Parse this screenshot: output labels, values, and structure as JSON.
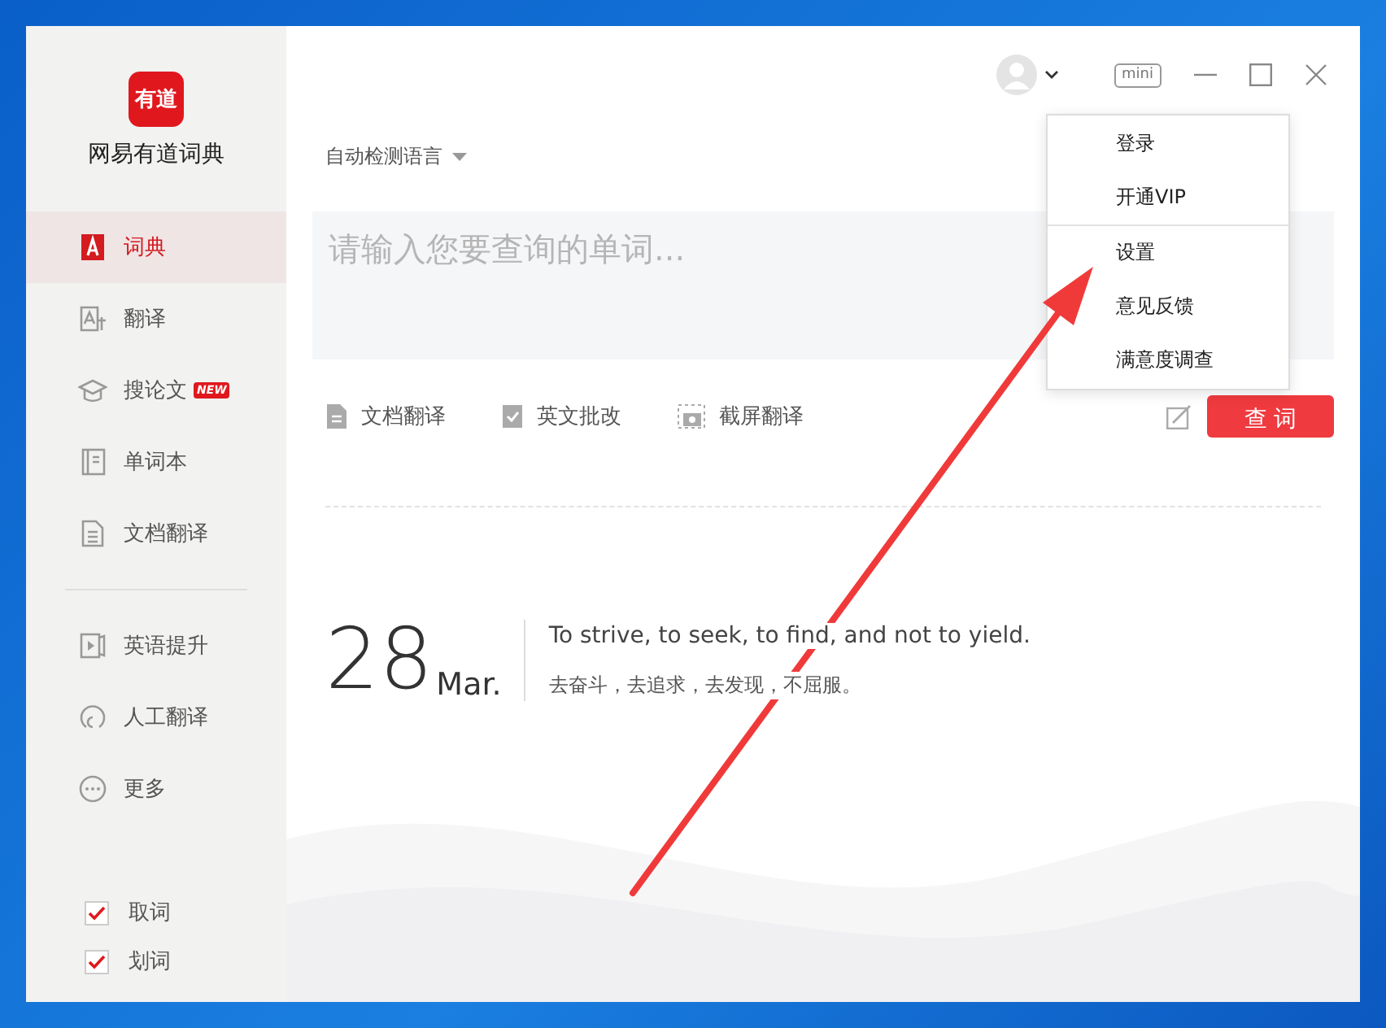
{
  "app": {
    "logo_text": "有道",
    "name": "网易有道词典"
  },
  "nav_groups": [
    [
      {
        "label": "词典",
        "selected": true
      },
      {
        "label": "翻译",
        "selected": false
      },
      {
        "label": "搜论文",
        "selected": false,
        "badge": "NEW"
      },
      {
        "label": "单词本",
        "selected": false
      },
      {
        "label": "文档翻译",
        "selected": false
      }
    ],
    [
      {
        "label": "英语提升",
        "selected": false
      },
      {
        "label": "人工翻译",
        "selected": false
      },
      {
        "label": "更多",
        "selected": false
      }
    ]
  ],
  "options": [
    {
      "label": "取词",
      "checked": true
    },
    {
      "label": "划词",
      "checked": true
    }
  ],
  "titlebar": {
    "mini": "mini"
  },
  "language": "自动检测语言",
  "search": {
    "placeholder": "请输入您要查询的单词..."
  },
  "tools": [
    {
      "label": "文档翻译"
    },
    {
      "label": "英文批改"
    },
    {
      "label": "截屏翻译"
    }
  ],
  "query_button": "查 词",
  "daily": {
    "day": "28",
    "month": "Mar.",
    "en": "To strive, to seek, to find, and not to yield.",
    "zh": "去奋斗，去追求，去发现，不屈服。"
  },
  "user_menu": {
    "groups": [
      [
        {
          "label": "登录"
        },
        {
          "label": "开通VIP"
        }
      ],
      [
        {
          "label": "设置"
        },
        {
          "label": "意见反馈"
        },
        {
          "label": "满意度调查"
        }
      ]
    ]
  }
}
